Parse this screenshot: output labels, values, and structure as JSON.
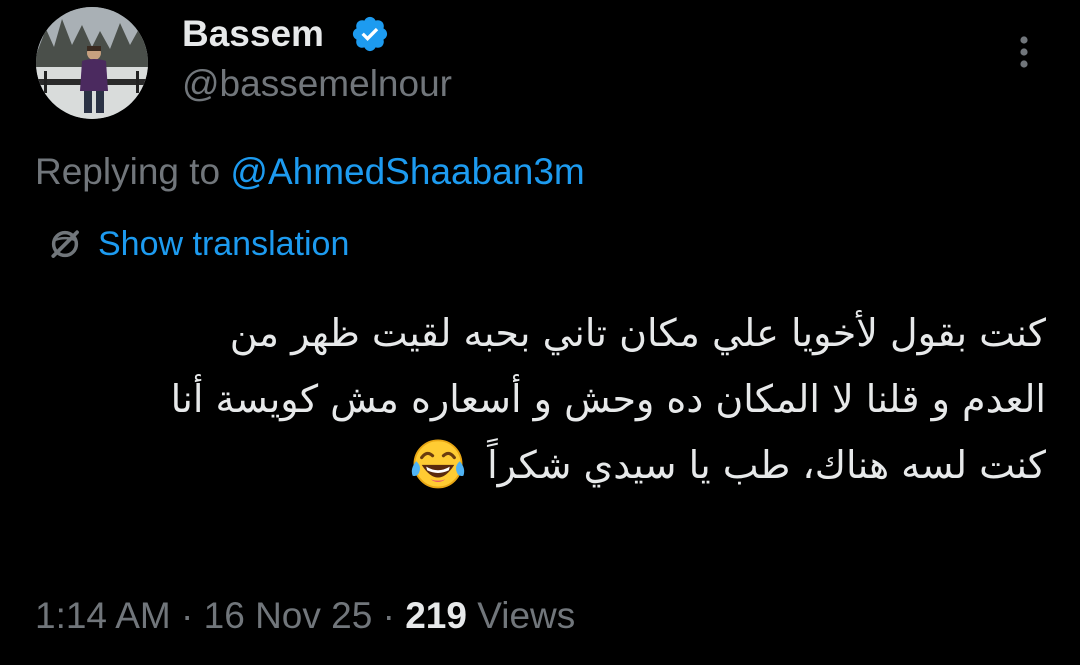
{
  "author": {
    "display_name": "Bassem",
    "handle": "@bassemelnour",
    "verified": true,
    "verified_color": "#1d9bf0"
  },
  "reply": {
    "prefix": "Replying to",
    "mention": "@AhmedShaaban3m"
  },
  "translation": {
    "label": "Show translation",
    "icon": "globe-slash-icon"
  },
  "tweet": {
    "lines": [
      "كنت بقول لأخويا علي مكان تاني بحبه لقيت ظهر من",
      "العدم و قلنا لا المكان ده وحش و أسعاره مش كويسة أنا",
      "كنت لسه هناك، طب يا سيدي شكراً"
    ],
    "emoji": "face-with-tears-of-joy"
  },
  "meta": {
    "time": "1:14 AM",
    "separator": "·",
    "date": "16 Nov 25",
    "views_count": "219",
    "views_label": "Views"
  },
  "colors": {
    "background": "#000000",
    "primary_text": "#e7e9ea",
    "secondary_text": "#71767b",
    "accent": "#1d9bf0"
  }
}
